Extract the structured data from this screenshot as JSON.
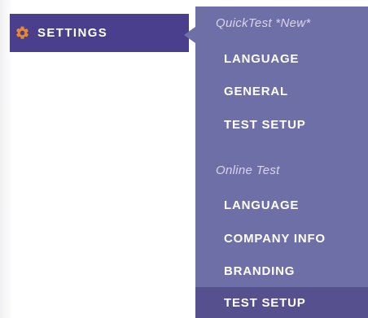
{
  "nav": {
    "settings": {
      "label": "SETTINGS",
      "icon": "gear-icon"
    }
  },
  "submenu": {
    "sections": [
      {
        "heading": "QuickTest *New*",
        "items": [
          "LANGUAGE",
          "GENERAL",
          "TEST SETUP"
        ]
      },
      {
        "heading": "Online Test",
        "items": [
          "LANGUAGE",
          "COMPANY INFO",
          "BRANDING",
          "TEST SETUP"
        ]
      }
    ],
    "active_item": "TEST SETUP"
  },
  "colors": {
    "nav_background": "#4a3f8c",
    "submenu_background": "#6f6fa8",
    "active_item_background": "#57508f",
    "icon_accent": "#e8892f"
  }
}
